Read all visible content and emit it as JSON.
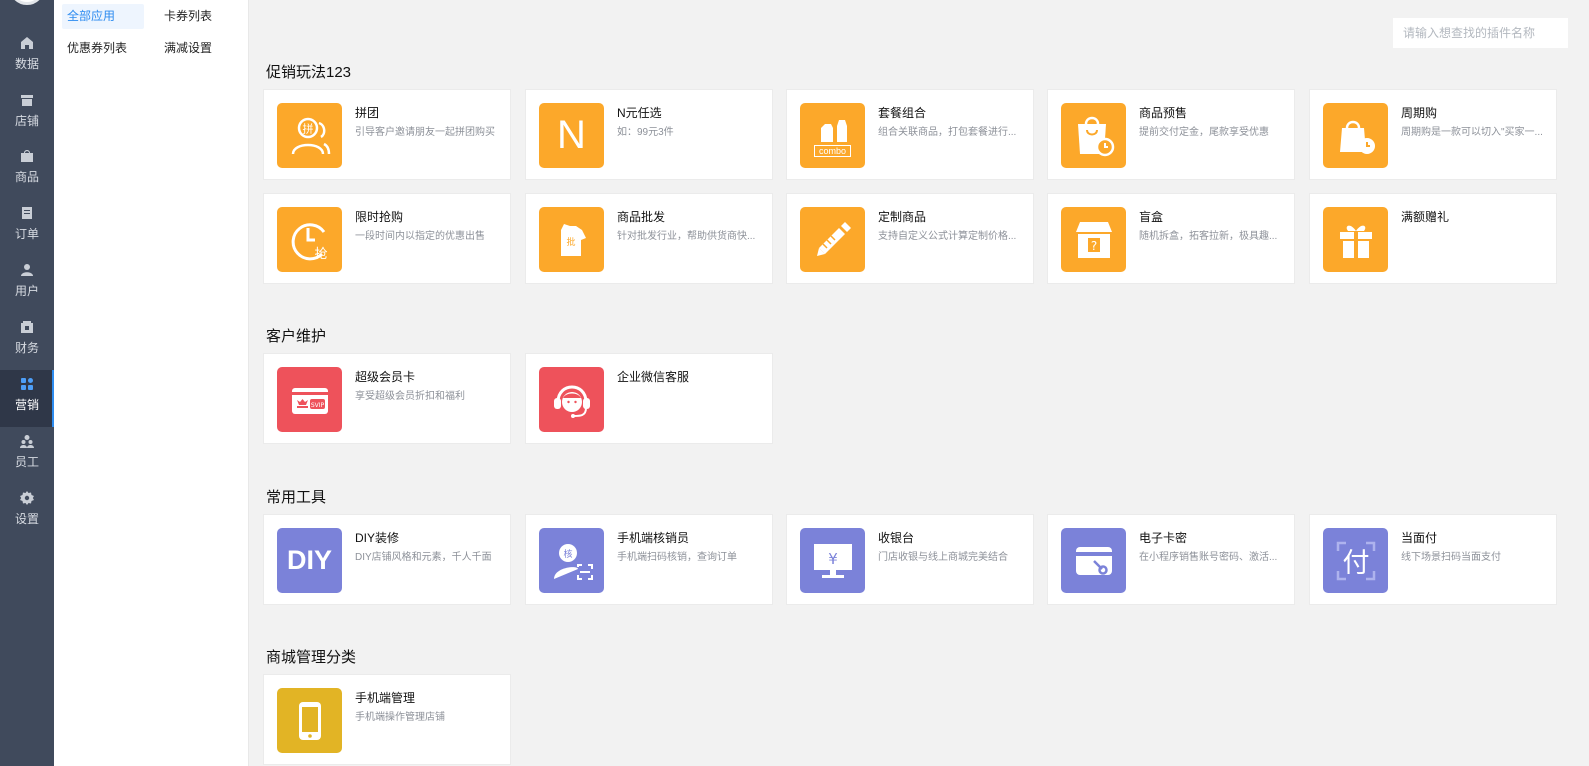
{
  "sidebar": {
    "items": [
      {
        "label": "数据",
        "icon": "home-icon"
      },
      {
        "label": "店铺",
        "icon": "store-icon"
      },
      {
        "label": "商品",
        "icon": "bag-icon"
      },
      {
        "label": "订单",
        "icon": "order-icon"
      },
      {
        "label": "用户",
        "icon": "user-icon"
      },
      {
        "label": "财务",
        "icon": "finance-icon"
      },
      {
        "label": "营销",
        "icon": "marketing-icon",
        "active": true
      },
      {
        "label": "员工",
        "icon": "staff-icon"
      },
      {
        "label": "设置",
        "icon": "gear-icon"
      }
    ]
  },
  "submenu": {
    "items": [
      {
        "label": "全部应用",
        "active": true
      },
      {
        "label": "卡券列表"
      },
      {
        "label": "优惠券列表"
      },
      {
        "label": "满减设置"
      }
    ]
  },
  "search": {
    "placeholder": "请输入想查找的插件名称"
  },
  "sections": [
    {
      "title": "促销玩法123",
      "cards": [
        {
          "name": "拼团",
          "desc": "引导客户邀请朋友一起拼团购买",
          "icon": "group-buy-icon",
          "color": "#fca82a"
        },
        {
          "name": "N元任选",
          "desc": "如：99元3件",
          "icon": "letter-n-icon",
          "icon_text": "N",
          "color": "#fca82a"
        },
        {
          "name": "套餐组合",
          "desc": "组合关联商品，打包套餐进行...",
          "icon": "combo-icon",
          "icon_text": "combo",
          "color": "#fca82a"
        },
        {
          "name": "商品预售",
          "desc": "提前交付定金，尾款享受优惠",
          "icon": "presale-bag-icon",
          "color": "#fca82a"
        },
        {
          "name": "周期购",
          "desc": "周期购是一款可以切入\"买家一...",
          "icon": "cycle-bag-icon",
          "color": "#fca82a"
        },
        {
          "name": "限时抢购",
          "desc": "一段时间内以指定的优惠出售",
          "icon": "flash-sale-clock-icon",
          "icon_text": "抢",
          "color": "#fca82a"
        },
        {
          "name": "商品批发",
          "desc": "针对批发行业，帮助供货商快...",
          "icon": "wholesale-shirt-icon",
          "icon_text": "批",
          "color": "#fca82a"
        },
        {
          "name": "定制商品",
          "desc": "支持自定义公式计算定制价格...",
          "icon": "pencil-ruler-icon",
          "color": "#fca82a"
        },
        {
          "name": "盲盒",
          "desc": "随机拆盒，拓客拉新，极具趣...",
          "icon": "blind-box-icon",
          "icon_text": "?",
          "color": "#fca82a"
        },
        {
          "name": "满额赠礼",
          "desc": "",
          "icon": "gift-icon",
          "color": "#fca82a"
        }
      ]
    },
    {
      "title": "客户维护",
      "cards": [
        {
          "name": "超级会员卡",
          "desc": "享受超级会员折扣和福利",
          "icon": "svip-card-icon",
          "icon_text": "SVIP",
          "color": "#ee525b"
        },
        {
          "name": "企业微信客服",
          "desc": "",
          "icon": "headset-icon",
          "color": "#ee525b"
        }
      ]
    },
    {
      "title": "常用工具",
      "cards": [
        {
          "name": "DIY装修",
          "desc": "DIY店铺风格和元素，千人千面",
          "icon": "diy-icon",
          "icon_text": "DIY",
          "color": "#7b82d9"
        },
        {
          "name": "手机端核销员",
          "desc": "手机端扫码核销，查询订单",
          "icon": "verifier-scan-icon",
          "icon_text": "核",
          "color": "#7b82d9"
        },
        {
          "name": "收银台",
          "desc": "门店收银与线上商城完美结合",
          "icon": "cashier-monitor-icon",
          "icon_text": "¥",
          "color": "#7b82d9"
        },
        {
          "name": "电子卡密",
          "desc": "在小程序销售账号密码、激活...",
          "icon": "e-card-key-icon",
          "color": "#7b82d9"
        },
        {
          "name": "当面付",
          "desc": "线下场景扫码当面支付",
          "icon": "pay-scan-icon",
          "icon_text": "付",
          "color": "#7b82d9"
        }
      ]
    },
    {
      "title": "商城管理分类",
      "cards": [
        {
          "name": "手机端管理",
          "desc": "手机端操作管理店铺",
          "icon": "mobile-phone-icon",
          "color": "#e2b425"
        }
      ]
    }
  ]
}
